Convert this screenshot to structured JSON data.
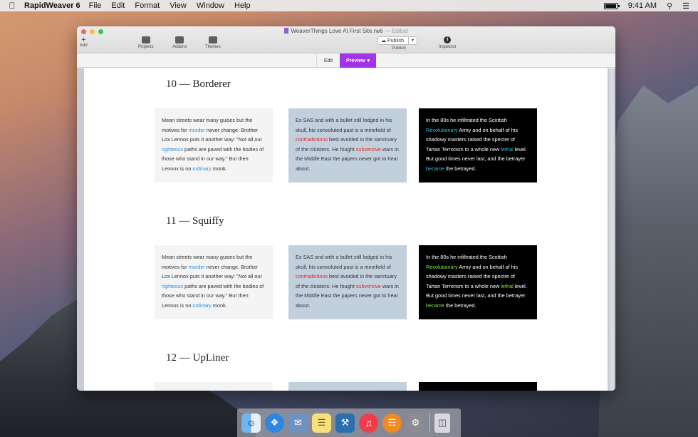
{
  "menubar": {
    "app_name": "RapidWeaver 6",
    "menus": [
      "File",
      "Edit",
      "Format",
      "View",
      "Window",
      "Help"
    ],
    "clock": "9:41 AM"
  },
  "window": {
    "title": "WeaverThings Love At First Site.rw6",
    "edited": "— Edited",
    "toolbar": {
      "add": "Add",
      "projects": "Projects",
      "addons": "Addons",
      "themes": "Themes",
      "publish_button": "Publish",
      "publish_label": "Publish",
      "inspector": "Inspector"
    },
    "modes": {
      "edit": "Edit",
      "preview": "Preview"
    }
  },
  "sections": [
    {
      "title": "10 — Borderer",
      "col1": {
        "t1": "Mean streets wear many guises but the motives for ",
        "k1": "murder",
        "t2": " never change. Brother Lox Lennox puts it another way: \"Not all our ",
        "k2": "righteous",
        "t3": " paths are paved with the bodies of those who stand in our way.\" But then Lennox is no ",
        "k3": "ordinary",
        "t4": " monk."
      },
      "col2": {
        "t1": "Ex SAS and with a bullet still lodged in his skull, his convoluted past is a minefield of ",
        "k1": "contradictions",
        "t2": " best avoided in the sanctuary of the cloisters. He fought ",
        "k2": "subversive",
        "t3": " wars in the Middle East the papers never got to hear about."
      },
      "col3": {
        "t1": "In the 80s he infiltrated the Scottish ",
        "k1": "Revolutionary",
        "t2": " Army and on behalf of his shadowy masters raised the spectre of Tartan Terrorism to a whole new ",
        "k2": "lethal",
        "t3": " level. But good times never last, and the betrayer ",
        "k3": "became",
        "t4": " the betrayed."
      }
    },
    {
      "title": "11 — Squiffy",
      "col1": {
        "t1": "Mean streets wear many guises but the motives for ",
        "k1": "murder",
        "t2": " never change. Brother Lox Lennox puts it another way: \"Not all our ",
        "k2": "righteous",
        "t3": " paths are paved with the bodies of those who stand in our way.\" But then Lennox is no ",
        "k3": "ordinary",
        "t4": " monk."
      },
      "col2": {
        "t1": "Ex SAS and with a bullet still lodged in his skull, his convoluted past is a minefield of ",
        "k1": "contradictions",
        "t2": " best avoided in the sanctuary of the cloisters. He fought ",
        "k2": "subversive",
        "t3": " wars in the Middle East the papers never got to hear about."
      },
      "col3": {
        "t1": "In the 80s he infiltrated the Scottish ",
        "k1": "Revolutionary",
        "t2": " Army and on behalf of his shadowy masters raised the spectre of Tartan Terrorism to a whole new ",
        "k2": "lethal",
        "t3": " level. But good times never last, and the betrayer ",
        "k3": "became",
        "t4": " the betrayed."
      }
    },
    {
      "title": "12 — UpLiner"
    }
  ],
  "dock": [
    "finder-icon",
    "safari-icon",
    "mail-icon",
    "notes-icon",
    "xcode-icon",
    "itunes-icon",
    "ibooks-icon",
    "system-preferences-icon",
    "trash-icon"
  ]
}
